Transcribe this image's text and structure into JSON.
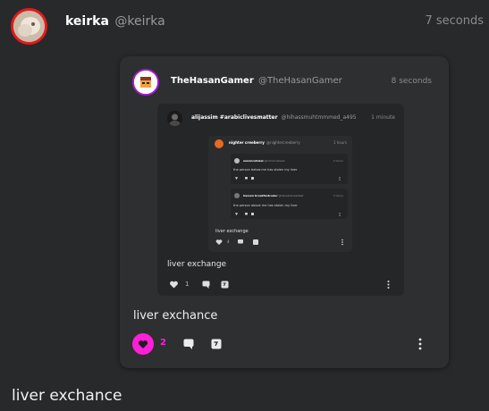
{
  "outer_post": {
    "author_name": "keirka",
    "author_handle": "@keirka",
    "time": "7 seconds",
    "text": "liver exchance"
  },
  "quoted_post": {
    "author_name": "TheHasanGamer",
    "author_handle": "@TheHasanGamer",
    "time": "8 seconds",
    "text": "liver exchance",
    "like_count": "2",
    "colors": {
      "liked_accent": "#ff1fd6"
    }
  },
  "quote_level2": {
    "author_name": "alijassim #arabiclivesmatter",
    "author_handle": "@hihassmuhtmmmed_a495",
    "time": "1 minute",
    "text": "liver exchange",
    "like_count": "1"
  },
  "quote_level3": {
    "author_name": "nighter creeberry",
    "author_handle": "@nightercreeberry",
    "time": "1 hours",
    "text": "liver exchange",
    "like_count": "4"
  },
  "quote_level4a": {
    "author_name": "mmdoretokal",
    "author_handle": "@mmdoretokal",
    "time": "2 hours",
    "text": "the person below me has stolen my liver"
  },
  "quote_level4b": {
    "author_name": "hassan breakfastcoder",
    "author_handle": "@hassanbreakfast",
    "time": "3 hours",
    "text": "the person above me has stolen my liver"
  }
}
